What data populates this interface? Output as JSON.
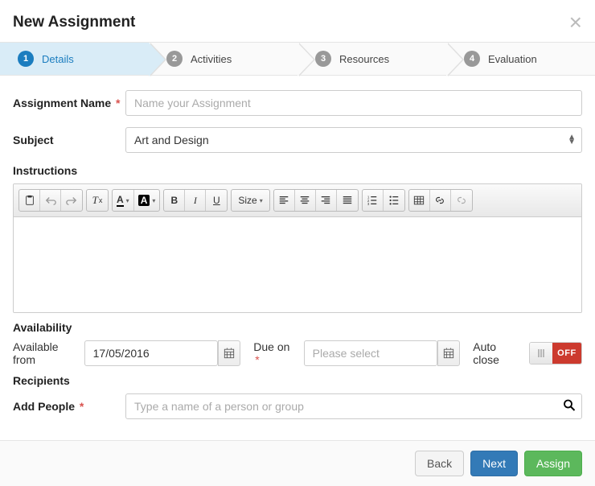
{
  "header": {
    "title": "New Assignment"
  },
  "stepper": {
    "steps": [
      {
        "num": "1",
        "label": "Details",
        "active": true
      },
      {
        "num": "2",
        "label": "Activities",
        "active": false
      },
      {
        "num": "3",
        "label": "Resources",
        "active": false
      },
      {
        "num": "4",
        "label": "Evaluation",
        "active": false
      }
    ]
  },
  "form": {
    "name_label": "Assignment Name",
    "name_placeholder": "Name your Assignment",
    "name_value": "",
    "subject_label": "Subject",
    "subject_value": "Art and Design",
    "instructions_label": "Instructions",
    "availability_label": "Availability",
    "available_from_label": "Available from",
    "available_from_value": "17/05/2016",
    "due_on_label": "Due on",
    "due_on_placeholder": "Please select",
    "auto_close_label": "Auto close",
    "auto_close_off": "OFF",
    "recipients_label": "Recipients",
    "add_people_label": "Add People",
    "add_people_placeholder": "Type a name of a person or group",
    "required_mark": "*"
  },
  "toolbar": {
    "size_label": "Size"
  },
  "footer": {
    "back": "Back",
    "next": "Next",
    "assign": "Assign"
  },
  "icons": {
    "close": "close-icon",
    "calendar": "calendar-icon",
    "search": "search-icon"
  }
}
